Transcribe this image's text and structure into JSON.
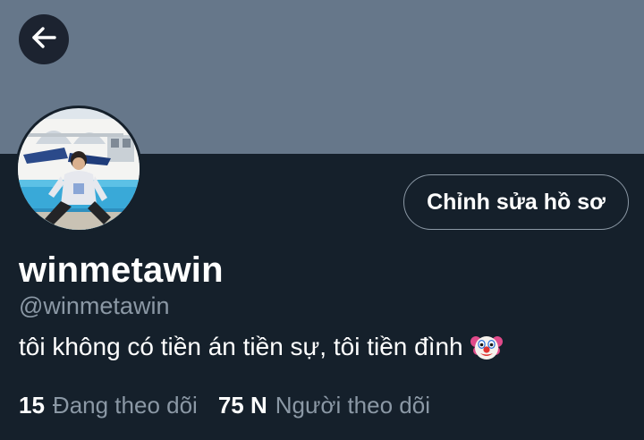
{
  "header": {
    "back_icon": "arrow-left-icon",
    "banner_color": "#66778a"
  },
  "profile": {
    "avatar_icon": "profile-photo",
    "edit_button_label": "Chỉnh sửa hồ sơ",
    "display_name": "winmetawin",
    "handle": "@winmetawin",
    "bio": "tôi không có tiền án tiền sự, tôi tiền đình",
    "bio_emoji": "clown-face-icon"
  },
  "stats": {
    "following_count": "15",
    "following_label": "Đang theo dõi",
    "followers_count": "75 N",
    "followers_label": "Người theo dõi"
  },
  "colors": {
    "background": "#15202b",
    "secondary_text": "#8b98a5",
    "primary_text": "#ffffff"
  }
}
